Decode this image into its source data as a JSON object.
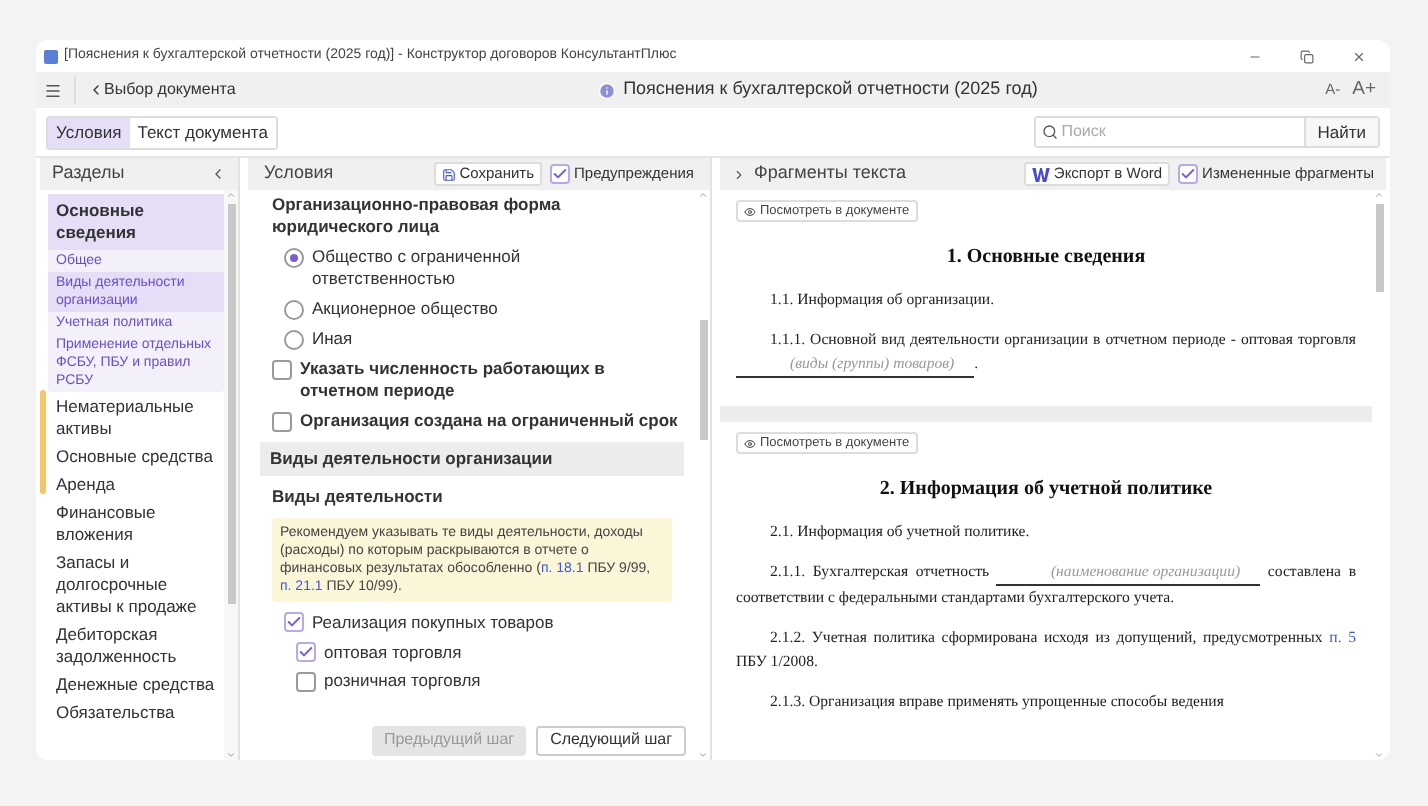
{
  "window": {
    "title": "[Пояснения к бухгалтерской отчетности (2025 год)] - Конструктор договоров КонсультантПлюс"
  },
  "toolbar": {
    "back": "Выбор документа",
    "document_title": "Пояснения к бухгалтерской отчетности (2025 год)",
    "font_smaller": "A-",
    "font_larger": "A+"
  },
  "tabs": [
    {
      "label": "Условия",
      "selected": true
    },
    {
      "label": "Текст документа",
      "selected": false
    }
  ],
  "search": {
    "placeholder": "Поиск",
    "button": "Найти"
  },
  "sidebar": {
    "title": "Разделы",
    "items": [
      {
        "label": "Основные сведения",
        "selected": true,
        "children": [
          {
            "label": "Общее",
            "selected": false
          },
          {
            "label": "Виды деятельности организации",
            "selected": true
          },
          {
            "label": "Учетная политика",
            "selected": false
          },
          {
            "label": "Применение отдельных ФСБУ, ПБУ и правил РСБУ",
            "selected": false
          }
        ]
      },
      {
        "label": "Нематериальные активы",
        "selected": false
      },
      {
        "label": "Основные средства",
        "selected": false
      },
      {
        "label": "Аренда",
        "selected": false
      },
      {
        "label": "Финансовые вложения",
        "selected": false
      },
      {
        "label": "Запасы и долгосрочные активы к продаже",
        "selected": false
      },
      {
        "label": "Дебиторская задолженность",
        "selected": false
      },
      {
        "label": "Денежные средства",
        "selected": false
      },
      {
        "label": "Обязательства",
        "selected": false
      }
    ]
  },
  "conditions": {
    "title": "Условия",
    "save": "Сохранить",
    "warnings": {
      "label": "Предупреждения",
      "checked": true
    },
    "items": [
      {
        "kind": "heading",
        "text": "Организационно-правовая форма юридического лица"
      },
      {
        "kind": "radio",
        "text": "Общество с ограниченной ответственностью",
        "selected": true
      },
      {
        "kind": "radio",
        "text": "Акционерное общество",
        "selected": false
      },
      {
        "kind": "radio",
        "text": "Иная",
        "selected": false
      },
      {
        "kind": "checkbox",
        "text": "Указать численность работающих в отчетном периоде",
        "checked": false
      },
      {
        "kind": "checkbox",
        "text": "Организация создана на ограниченный срок",
        "checked": false
      },
      {
        "kind": "section",
        "text": "Виды деятельности организации"
      },
      {
        "kind": "heading",
        "text": "Виды деятельности"
      },
      {
        "kind": "note",
        "parts": [
          {
            "kind": "text",
            "text": "Рекомендуем указывать те виды деятельности, доходы (расходы) по которым раскрываются в отчете о финансовых результатах обособленно ("
          },
          {
            "kind": "link",
            "text": "п. 18.1"
          },
          {
            "kind": "text",
            "text": " ПБУ 9/99, "
          },
          {
            "kind": "link",
            "text": "п. 21.1"
          },
          {
            "kind": "text",
            "text": " ПБУ 10/99)."
          }
        ]
      },
      {
        "kind": "option",
        "text": "Реализация покупных товаров",
        "checked": true,
        "children": [
          {
            "text": "оптовая торговля",
            "checked": true
          },
          {
            "text": "розничная торговля",
            "checked": false
          }
        ]
      }
    ],
    "previous": "Предыдущий шаг",
    "previous_disabled": true,
    "next": "Следующий шаг"
  },
  "fragments": {
    "title": "Фрагменты текста",
    "export": "Экспорт в Word",
    "changed": {
      "label": "Измененные фрагменты",
      "checked": true
    },
    "items": [
      {
        "button": "Посмотреть в документе",
        "heading": "1.  Основные сведения",
        "paragraphs": [
          [
            {
              "kind": "text",
              "text": "1.1.  Информация об организации."
            }
          ],
          [
            {
              "kind": "text",
              "text": "1.1.1. Основной вид деятельности организации в отчетном периоде - оптовая торговля "
            },
            {
              "kind": "blank",
              "text": "(виды (группы) товаров)"
            },
            {
              "kind": "text",
              "text": "."
            }
          ]
        ]
      },
      {
        "button": "Посмотреть в документе",
        "heading": "2.  Информация об учетной политике",
        "paragraphs": [
          [
            {
              "kind": "text",
              "text": "2.1.  Информация об учетной политике."
            }
          ],
          [
            {
              "kind": "text",
              "text": "2.1.1. Бухгалтерская отчетность "
            },
            {
              "kind": "blank",
              "text": "(наименование организации)"
            },
            {
              "kind": "text",
              "text": " составлена в соответствии с федеральными стандартами бухгалтерского учета."
            }
          ],
          [
            {
              "kind": "text",
              "text": "2.1.2. Учетная политика сформирована исходя из допущений, предусмотренных "
            },
            {
              "kind": "link",
              "text": "п. 5"
            },
            {
              "kind": "text",
              "text": " ПБУ 1/2008."
            }
          ],
          [
            {
              "kind": "text",
              "text": "2.1.3. Организация вправе применять упрощенные способы ведения"
            }
          ]
        ]
      }
    ]
  }
}
